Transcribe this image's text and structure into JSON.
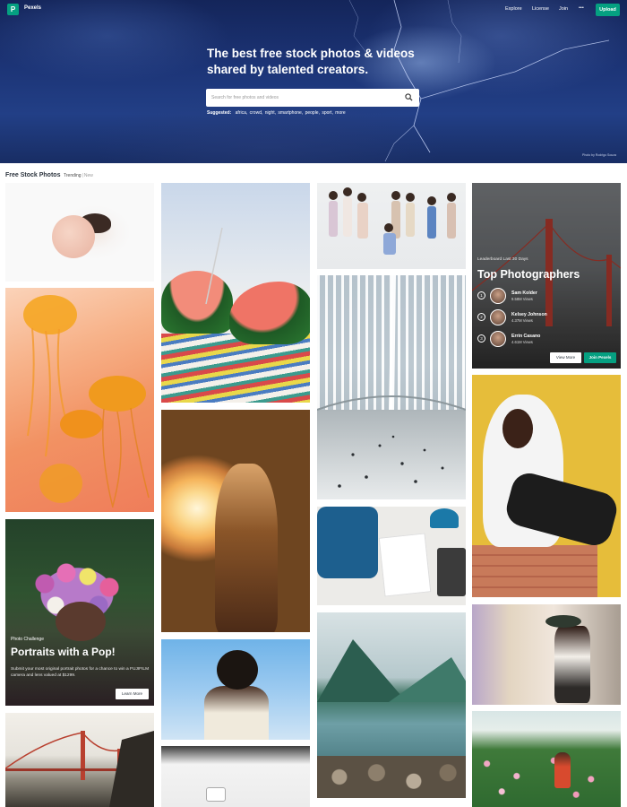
{
  "header": {
    "logo_letter": "P",
    "logo_text": "Pexels",
    "nav": [
      "Explore",
      "License",
      "Join"
    ],
    "more_label": "•••",
    "upload_label": "Upload"
  },
  "hero": {
    "title": "The best free stock photos & videos shared by talented creators.",
    "search_placeholder": "Search for free photos and videos",
    "suggested_label": "Suggested:",
    "suggested": [
      "africa,",
      "crowd,",
      "night,",
      "smartphone,",
      "people,",
      "sport,",
      "more"
    ],
    "credit": "Photo by Rodrigo Souza"
  },
  "section": {
    "title": "Free Stock Photos",
    "tabs": [
      "Trending",
      "New"
    ],
    "separator": "|"
  },
  "promo": {
    "label": "Photo Challenge",
    "title": "Portraits with a Pop!",
    "description": "Submit your most original portrait photos for a chance to win a FUJIFILM camera and lens valued at $1299.",
    "button": "Learn More"
  },
  "leaderboard": {
    "label": "Leaderboard Last 30 Days",
    "title": "Top Photographers",
    "photographers": [
      {
        "rank": "1",
        "name": "Sam Kolder",
        "views": "9.58M Views"
      },
      {
        "rank": "2",
        "name": "Kelsey Johnson",
        "views": "4.37M Views"
      },
      {
        "rank": "3",
        "name": "Errin Casano",
        "views": "4.61M Views"
      }
    ],
    "view_more": "View More",
    "join": "Join Pexels"
  },
  "colors": {
    "accent": "#05a081",
    "text_dark": "#2c343e"
  }
}
